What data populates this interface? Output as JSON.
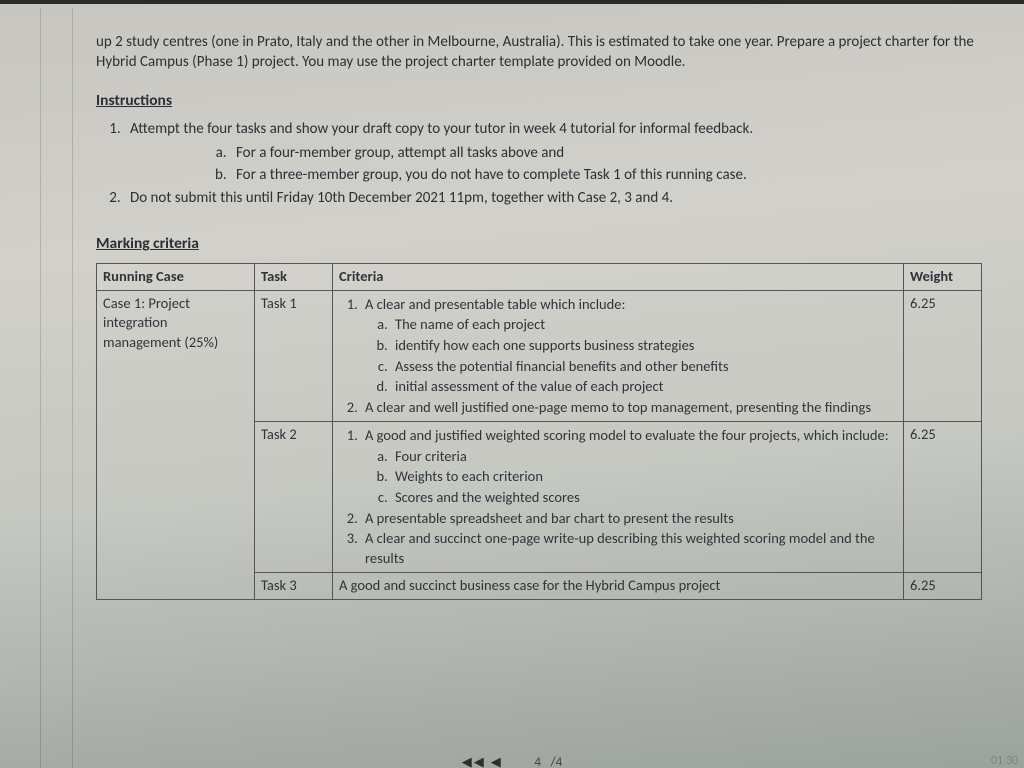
{
  "intro": "up 2 study centres (one in Prato, Italy and the other in Melbourne, Australia).  This is estimated to take one year. Prepare a project charter for the Hybrid Campus (Phase 1) project. You may use the project charter template provided on Moodle.",
  "headings": {
    "instructions": "Instructions",
    "marking": "Marking criteria"
  },
  "instructions": {
    "item1": "Attempt the four tasks and show your draft copy to your tutor in week 4 tutorial for informal feedback.",
    "item1a": "For a four-member group, attempt all tasks above and",
    "item1b": "For a three-member group, you do not have to complete Task 1 of this running case.",
    "item2": "Do not submit this until Friday 10th December 2021 11pm, together with Case 2, 3 and 4."
  },
  "table": {
    "headers": {
      "case": "Running Case",
      "task": "Task",
      "criteria": "Criteria",
      "weight": "Weight"
    },
    "case1": {
      "name": "Case 1: Project integration management (25%)"
    },
    "rows": [
      {
        "task": "Task 1",
        "weight": "6.25",
        "c1": "A clear and presentable table which include:",
        "c1a": "The name of each project",
        "c1b": "identify how each one supports business strategies",
        "c1c": "Assess the potential financial benefits and other benefits",
        "c1d": "initial assessment of the value of each project",
        "c2": "A clear and well justified one-page memo to top management, presenting the findings"
      },
      {
        "task": "Task 2",
        "weight": "6.25",
        "c1": "A good and justified weighted scoring model to evaluate the four projects, which include:",
        "c1a": "Four criteria",
        "c1b": "Weights to each criterion",
        "c1c": "Scores and the weighted scores",
        "c2": "A presentable spreadsheet and bar chart to present the results",
        "c3": "A clear and succinct one-page write-up describing this weighted scoring model and the results"
      },
      {
        "task": "Task 3",
        "weight": "6.25",
        "c1": "A good and succinct business case for the Hybrid Campus project"
      }
    ]
  },
  "footer": {
    "nav": "◀◀ ◀",
    "page_cur": "4",
    "page_sep": "/4"
  },
  "corner": "01  30"
}
